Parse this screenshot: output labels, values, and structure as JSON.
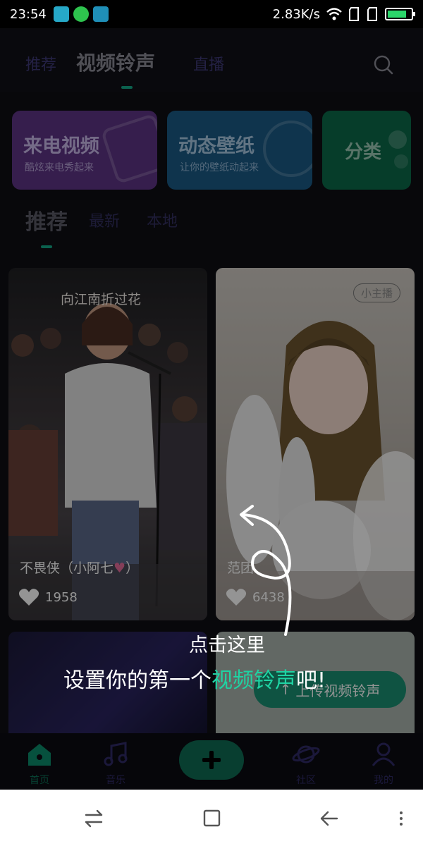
{
  "status_bar": {
    "time": "23:54",
    "speed": "2.83K/s",
    "battery_level": 0.8,
    "colors": {
      "accent": "#14a887"
    }
  },
  "top_tabs": [
    {
      "label": "推荐",
      "active": false
    },
    {
      "label": "视频铃声",
      "active": true
    },
    {
      "label": "直播",
      "active": false
    }
  ],
  "feature_cards": [
    {
      "title": "来电视频",
      "subtitle": "酷炫来电秀起来",
      "color": "#7a3ea8"
    },
    {
      "title": "动态壁纸",
      "subtitle": "让你的壁纸动起来",
      "color": "#1f6ea3"
    },
    {
      "title": "分类",
      "subtitle": "",
      "color": "#0c7a55"
    }
  ],
  "sub_tabs": [
    {
      "label": "推荐",
      "active": true
    },
    {
      "label": "最新",
      "active": false
    },
    {
      "label": "本地",
      "active": false
    }
  ],
  "videos": [
    {
      "overlay_text": "向江南折过花",
      "caption": "不畏侠（小阿七",
      "likes": "1958",
      "badge": ""
    },
    {
      "overlay_text": "",
      "caption": "范团",
      "likes": "6438",
      "badge": "小主播"
    }
  ],
  "upload_button": "上传视频铃声",
  "bottom_nav": [
    {
      "label": "首页",
      "icon": "home-icon"
    },
    {
      "label": "音乐",
      "icon": "music-note-icon"
    },
    {
      "label": "",
      "icon": "plus-icon"
    },
    {
      "label": "社区",
      "icon": "planet-icon"
    },
    {
      "label": "我的",
      "icon": "person-icon"
    }
  ],
  "hint": {
    "line1": "点击这里",
    "line2_prefix": "设置你的第一个",
    "line2_highlight": "视频铃声",
    "line2_suffix": "吧!"
  },
  "icons": {
    "status": [
      "sim-app-icon",
      "wechat-icon",
      "usb-icon",
      "wifi-icon",
      "signal-icon",
      "battery-icon"
    ],
    "android_nav": [
      "switch-icon",
      "home-square-icon",
      "back-icon",
      "menu-dots-icon"
    ]
  }
}
